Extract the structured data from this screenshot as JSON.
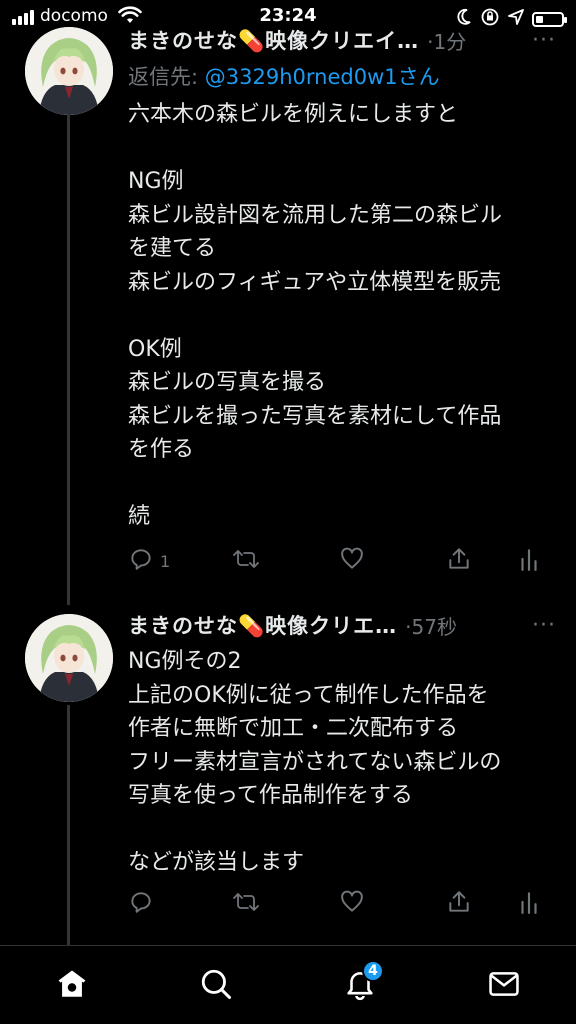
{
  "status_bar": {
    "carrier": "docomo",
    "time": "23:24",
    "battery_level": 0.3
  },
  "tweets": [
    {
      "author_name": "まきのせな💊映像クリエイ…",
      "time": "·1分",
      "reply_label": "返信先: ",
      "reply_handle": "@3329h0rned0w1さん",
      "lines": [
        "六本木の森ビルを例えにしますと",
        "",
        "NG例",
        "森ビル設計図を流用した第二の森ビル",
        "を建てる",
        "森ビルのフィギュアや立体模型を販売",
        "",
        "OK例",
        "森ビルの写真を撮る",
        "森ビルを撮った写真を素材にして作品",
        "を作る",
        "",
        "続"
      ],
      "reply_count": "1",
      "retweet_count": "",
      "like_count": ""
    },
    {
      "author_name": "まきのせな💊映像クリエ…",
      "time": "·57秒",
      "lines": [
        "NG例その2",
        "上記のOK例に従って制作した作品を",
        "作者に無断で加工・二次配布する",
        "フリー素材宣言がされてない森ビルの",
        "写真を使って作品制作をする",
        "",
        "などが該当します"
      ],
      "reply_count": "",
      "retweet_count": "",
      "like_count": ""
    }
  ],
  "bottom_nav": {
    "notifications_badge": "4",
    "items": [
      "home",
      "search",
      "notifications",
      "messages"
    ]
  },
  "colors": {
    "background": "#000000",
    "text": "#e7e9ea",
    "secondary": "#71767b",
    "accent": "#1d9bf0"
  }
}
